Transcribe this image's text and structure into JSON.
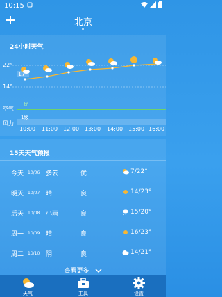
{
  "status": {
    "time": "10:15"
  },
  "header": {
    "city": "北京"
  },
  "hourly": {
    "title": "24小时天气",
    "temp_high_label": "22°",
    "temp_low_label": "14°",
    "current_temp": "17°",
    "air_label": "空气",
    "air_value": "优",
    "wind_label": "风力",
    "wind_value": "1级",
    "hours": [
      "10:00",
      "11:00",
      "12:00",
      "13:00",
      "14:00",
      "15:00",
      "16:00"
    ],
    "accent": "#f7b733"
  },
  "daily": {
    "title": "15天天气预报",
    "days": [
      {
        "day": "今天",
        "date": "10/06",
        "weather": "多云",
        "air": "优",
        "icon": "cloudy-icon",
        "temp": "7/22°"
      },
      {
        "day": "明天",
        "date": "10/07",
        "weather": "晴",
        "air": "良",
        "icon": "sun-icon",
        "temp": "14/23°"
      },
      {
        "day": "后天",
        "date": "10/08",
        "weather": "小雨",
        "air": "良",
        "icon": "rain-icon",
        "temp": "15/20°"
      },
      {
        "day": "周一",
        "date": "10/09",
        "weather": "晴",
        "air": "良",
        "icon": "sun-icon",
        "temp": "16/23°"
      },
      {
        "day": "周二",
        "date": "10/10",
        "weather": "阴",
        "air": "良",
        "icon": "overcast-icon",
        "temp": "14/21°"
      }
    ],
    "more_label": "查看更多"
  },
  "tabs": [
    {
      "label": "天气",
      "icon": "weather-icon"
    },
    {
      "label": "工具",
      "icon": "toolbox-icon"
    },
    {
      "label": "设置",
      "icon": "gear-icon"
    }
  ]
}
